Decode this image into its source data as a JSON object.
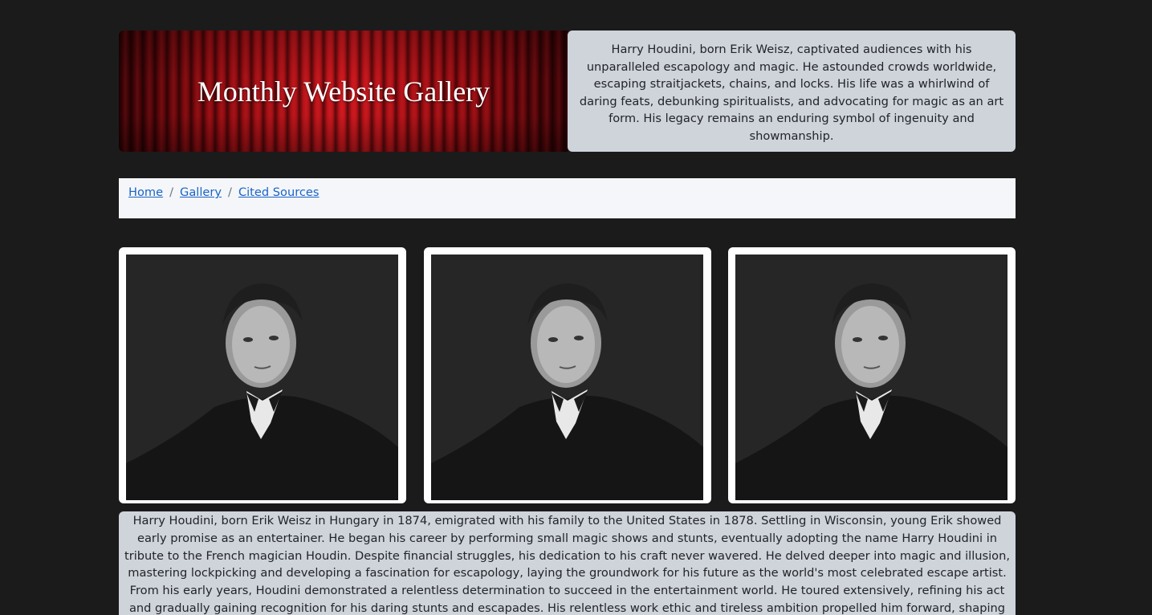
{
  "banner": {
    "title": "Monthly Website Gallery"
  },
  "intro": {
    "text": "Harry Houdini, born Erik Weisz, captivated audiences with his unparalleled escapology and magic. He astounded crowds worldwide, escaping straitjackets, chains, and locks. His life was a whirlwind of daring feats, debunking spiritualists, and advocating for magic as an art form. His legacy remains an enduring symbol of ingenuity and showmanship."
  },
  "breadcrumb": {
    "items": [
      {
        "label": "Home"
      },
      {
        "label": "Gallery"
      },
      {
        "label": "Cited Sources"
      }
    ],
    "separator": "/"
  },
  "gallery": {
    "images": [
      {
        "subject": "portrait-of-harry-houdini"
      },
      {
        "subject": "portrait-of-harry-houdini"
      },
      {
        "subject": "portrait-of-harry-houdini"
      }
    ]
  },
  "bio": {
    "paragraphs": [
      "Harry Houdini, born Erik Weisz in Hungary in 1874, emigrated with his family to the United States in 1878. Settling in Wisconsin, young Erik showed early promise as an entertainer. He began his career by performing small magic shows and stunts, eventually adopting the name Harry Houdini in tribute to the French magician Houdin. Despite financial struggles, his dedication to his craft never wavered. He delved deeper into magic and illusion, mastering lockpicking and developing a fascination for escapology, laying the groundwork for his future as the world's most celebrated escape artist.",
      "From his early years, Houdini demonstrated a relentless determination to succeed in the entertainment world. He toured extensively, refining his act and gradually gaining recognition for his daring stunts and escapades. His relentless work ethic and tireless ambition propelled him forward, shaping him into the"
    ]
  },
  "colors": {
    "background": "#1b1b1b",
    "panel": "#cfd3da",
    "breadcrumb_bg": "#f4f6f9",
    "link": "#1a64c8",
    "curtain_red": "#c8151b"
  }
}
